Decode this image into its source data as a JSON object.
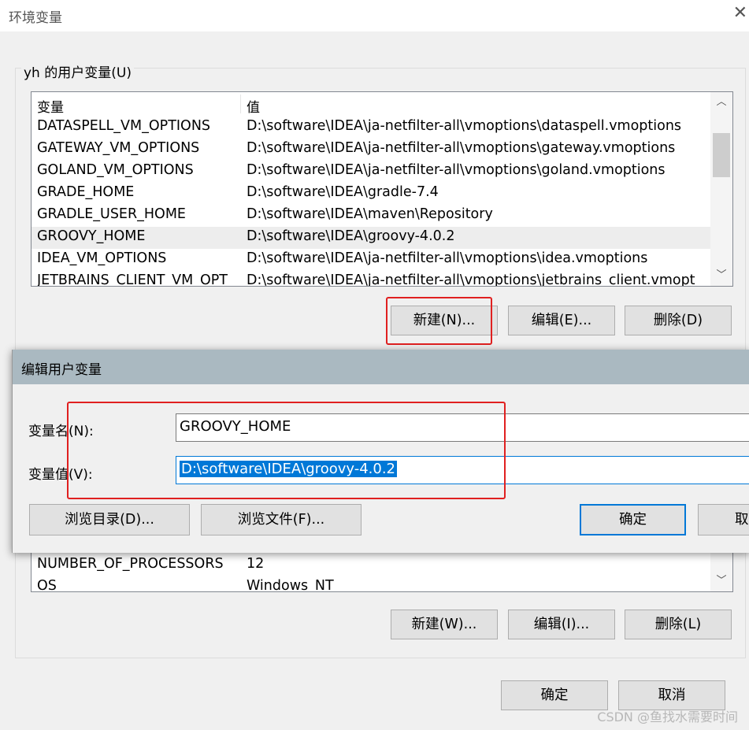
{
  "window": {
    "title": "环境变量",
    "close_glyph": "✕"
  },
  "user_vars": {
    "group_label": "yh 的用户变量(U)",
    "columns": {
      "name": "变量",
      "value": "值"
    },
    "rows": [
      {
        "name": "DATASPELL_VM_OPTIONS",
        "value": "D:\\software\\IDEA\\ja-netfilter-all\\vmoptions\\dataspell.vmoptions"
      },
      {
        "name": "GATEWAY_VM_OPTIONS",
        "value": "D:\\software\\IDEA\\ja-netfilter-all\\vmoptions\\gateway.vmoptions"
      },
      {
        "name": "GOLAND_VM_OPTIONS",
        "value": "D:\\software\\IDEA\\ja-netfilter-all\\vmoptions\\goland.vmoptions"
      },
      {
        "name": "GRADE_HOME",
        "value": "D:\\software\\IDEA\\gradle-7.4"
      },
      {
        "name": "GRADLE_USER_HOME",
        "value": "D:\\software\\IDEA\\maven\\Repository"
      },
      {
        "name": "GROOVY_HOME",
        "value": "D:\\software\\IDEA\\groovy-4.0.2"
      },
      {
        "name": "IDEA_VM_OPTIONS",
        "value": "D:\\software\\IDEA\\ja-netfilter-all\\vmoptions\\idea.vmoptions"
      },
      {
        "name": "JETBRAINS_CLIENT_VM_OPT",
        "value": "D:\\software\\IDEA\\ja-netfilter-all\\vmoptions\\jetbrains_client.vmopt"
      }
    ],
    "selected_row": "GROOVY_HOME",
    "buttons": {
      "new": "新建(N)...",
      "edit": "编辑(E)...",
      "delete": "删除(D)"
    }
  },
  "system_vars": {
    "rows": [
      {
        "name": "NUMBER_OF_PROCESSORS",
        "value": "12"
      },
      {
        "name": "OS",
        "value": "Windows_NT"
      }
    ],
    "buttons": {
      "new": "新建(W)...",
      "edit": "编辑(I)...",
      "delete": "删除(L)"
    }
  },
  "footer": {
    "ok": "确定",
    "cancel": "取消"
  },
  "dialog": {
    "title": "编辑用户变量",
    "name_label": "变量名(N):",
    "value_label": "变量值(V):",
    "name_value": "GROOVY_HOME",
    "value_value": "D:\\software\\IDEA\\groovy-4.0.2",
    "browse_dir": "浏览目录(D)...",
    "browse_file": "浏览文件(F)...",
    "ok": "确定",
    "cancel_partial": "取"
  },
  "scroll_glyphs": {
    "up": "︿",
    "down": "﹀"
  },
  "watermark": "CSDN @鱼找水需要时间",
  "colors": {
    "accent": "#0078d7",
    "highlight_box": "#e02020",
    "dialog_title_bg": "#aab9c1"
  }
}
